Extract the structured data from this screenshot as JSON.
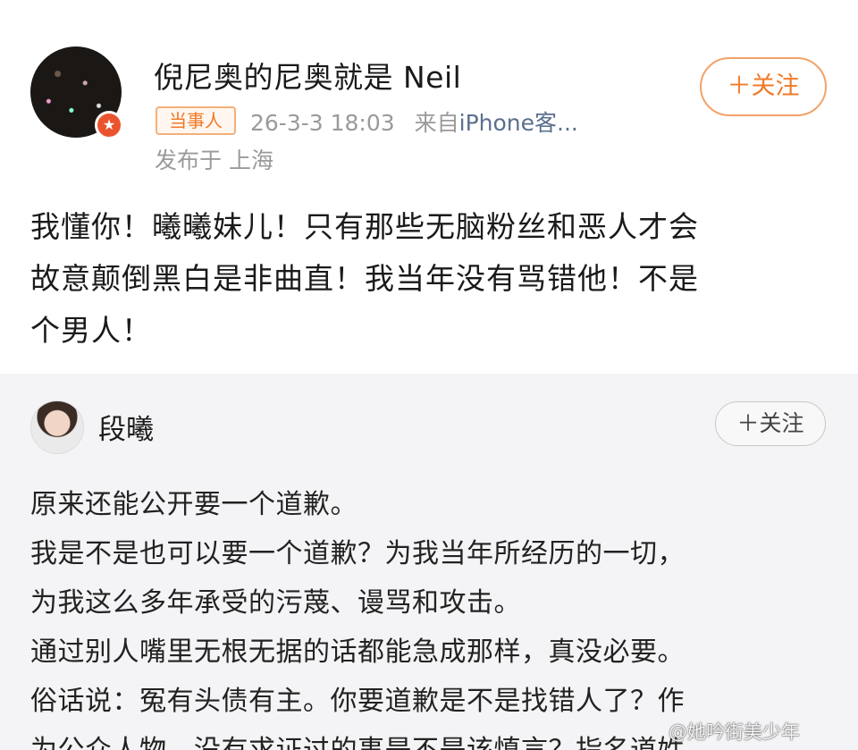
{
  "post": {
    "author": "倪尼奥的尼奥就是 Neil",
    "follow_label": "＋关注",
    "tag": "当事人",
    "time": "26-3-3 18:03",
    "source_prefix": "来自",
    "source": "iPhone客...",
    "location": "发布于 上海",
    "text_lines": [
      "我懂你！曦曦妹儿！只有那些无脑粉丝和恶人才会",
      "故意颠倒黑白是非曲直！我当年没有骂错他！不是",
      "个男人！"
    ]
  },
  "quoted": {
    "author": "段曦",
    "follow_label": "＋关注",
    "text_lines": [
      "原来还能公开要一个道歉。",
      "我是不是也可以要一个道歉？为我当年所经历的一切，",
      "为我这么多年承受的污蔑、谩骂和攻击。",
      "通过别人嘴里无根无据的话都能急成那样，真没必要。",
      "俗话说：冤有头债有主。你要道歉是不是找错人了？作",
      "为公众人物，没有求证过的事是不是该慎言？指名道姓"
    ]
  },
  "watermark": "@她吟街美少年"
}
